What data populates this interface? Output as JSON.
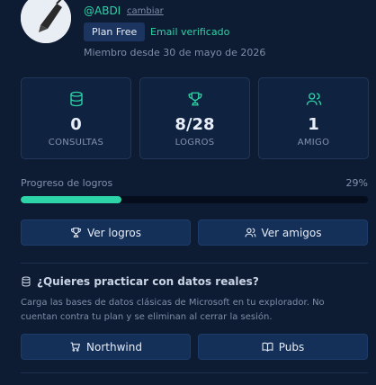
{
  "profile": {
    "username": "@ABDI",
    "change_label": "cambiar",
    "plan": "Plan Free",
    "email_status": "Email verificado",
    "member_since": "Miembro desde 30 de mayo de 2026"
  },
  "stats": [
    {
      "value": "0",
      "label": "CONSULTAS",
      "icon": "database-icon"
    },
    {
      "value": "8/28",
      "label": "LOGROS",
      "icon": "trophy-icon"
    },
    {
      "value": "1",
      "label": "AMIGO",
      "icon": "users-icon"
    }
  ],
  "progress": {
    "label": "Progreso de logros",
    "percent_text": "29%",
    "fraction": 0.29
  },
  "actions": {
    "achievements_label": "Ver logros",
    "friends_label": "Ver amigos"
  },
  "practice": {
    "title": "¿Quieres practicar con datos reales?",
    "description": "Carga las bases de datos clásicas de Microsoft en tu explorador. No cuentan contra tu plan y se eliminan al cerrar la sesión.",
    "northwind_label": "Northwind",
    "pubs_label": "Pubs"
  },
  "colors": {
    "accent": "#2dd4a7",
    "background": "#0d1b33",
    "card": "#0f2240",
    "button": "#143058"
  }
}
